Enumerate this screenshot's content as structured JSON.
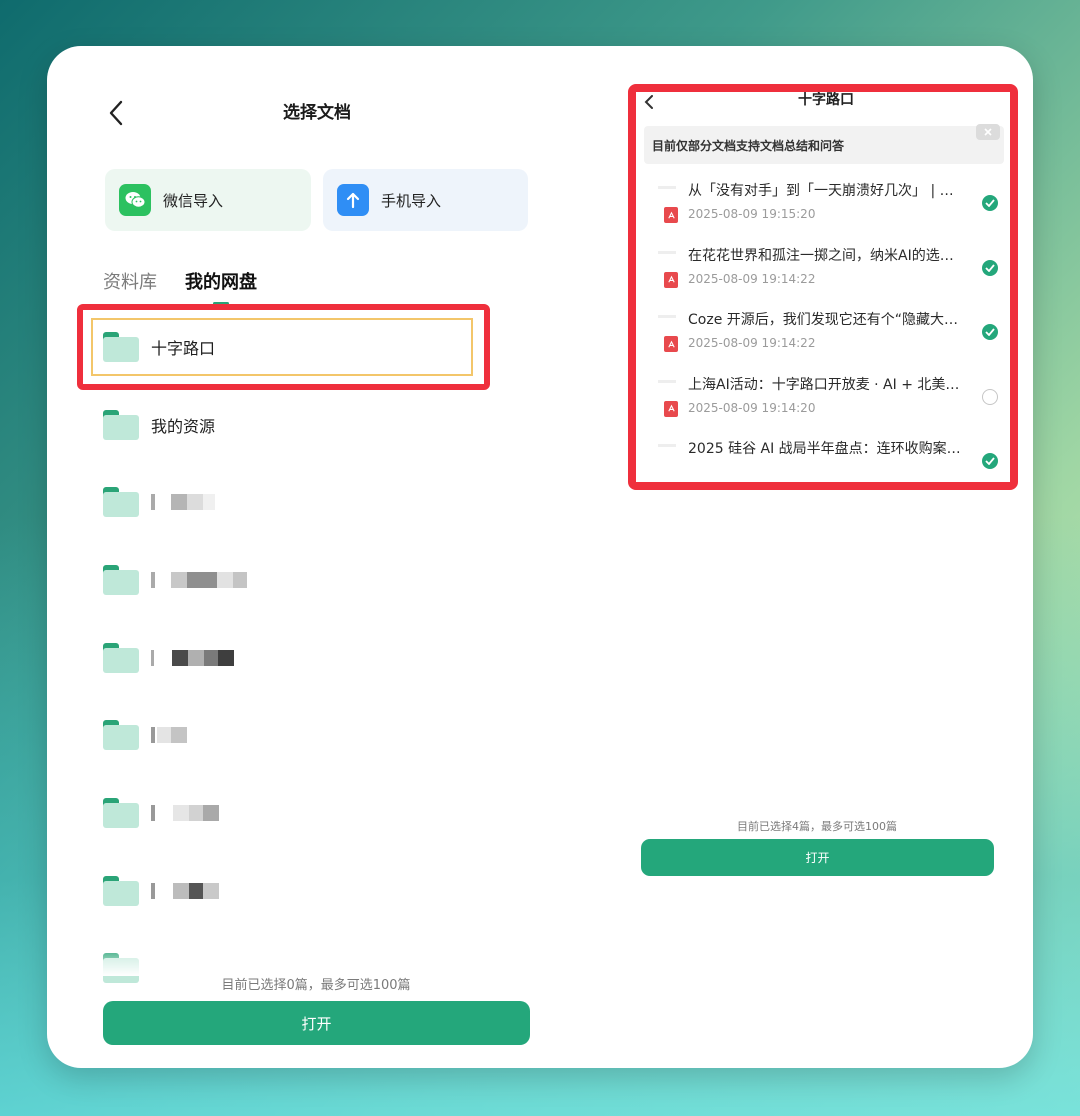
{
  "left": {
    "title": "选择文档",
    "import_buttons": [
      {
        "label": "微信导入",
        "icon": "wechat-icon"
      },
      {
        "label": "手机导入",
        "icon": "upload-arrow-icon"
      }
    ],
    "tabs": [
      {
        "label": "资料库",
        "active": false
      },
      {
        "label": "我的网盘",
        "active": true
      }
    ],
    "folders": [
      {
        "name": "十字路口"
      },
      {
        "name": "我的资源"
      }
    ],
    "status": "目前已选择0篇，最多可选100篇",
    "open_label": "打开"
  },
  "right": {
    "title": "十字路口",
    "notice": "目前仅部分文档支持文档总结和问答",
    "documents": [
      {
        "title": "从「没有对手」到「一天崩溃好几次」 | …",
        "date": "2025-08-09 19:15:20",
        "checked": true
      },
      {
        "title": "在花花世界和孤注一掷之间，纳米AI的选…",
        "date": "2025-08-09 19:14:22",
        "checked": true
      },
      {
        "title": "Coze 开源后，我们发现它还有个“隐藏大…",
        "date": "2025-08-09 19:14:22",
        "checked": true
      },
      {
        "title": "上海AI活动：十字路口开放麦 · AI + 北美…",
        "date": "2025-08-09 19:14:20",
        "checked": false
      },
      {
        "title": "2025 硅谷 AI 战局半年盘点：连环收购案…",
        "date": "",
        "checked": true
      }
    ],
    "status": "目前已选择4篇，最多可选100篇",
    "open_label": "打开"
  },
  "colors": {
    "accent": "#24a77b",
    "highlight": "#ef2f3c",
    "folder_body": "#bfe8d9",
    "pdf": "#e8494d"
  }
}
